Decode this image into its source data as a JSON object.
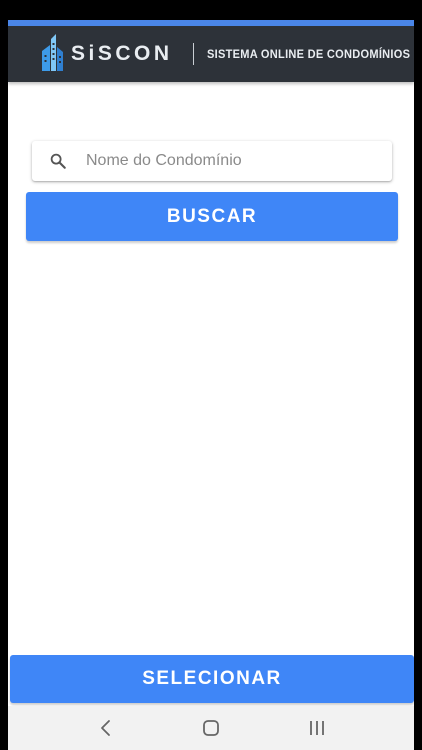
{
  "header": {
    "logo_text": "SiSCON",
    "tagline": "SISTEMA ONLINE DE CONDOMÍNIOS",
    "logo_icon": "building-logo-icon",
    "accent_color": "#4a86e8",
    "background_color": "#2d3239"
  },
  "search": {
    "placeholder": "Nome do Condomínio",
    "value": "",
    "icon": "search-icon"
  },
  "buttons": {
    "search_label": "BUSCAR",
    "select_label": "SELECIONAR",
    "color": "#3f86f7"
  },
  "navigation": {
    "items": [
      {
        "name": "back",
        "icon": "back-icon"
      },
      {
        "name": "home",
        "icon": "home-icon"
      },
      {
        "name": "recents",
        "icon": "recents-icon"
      }
    ]
  }
}
